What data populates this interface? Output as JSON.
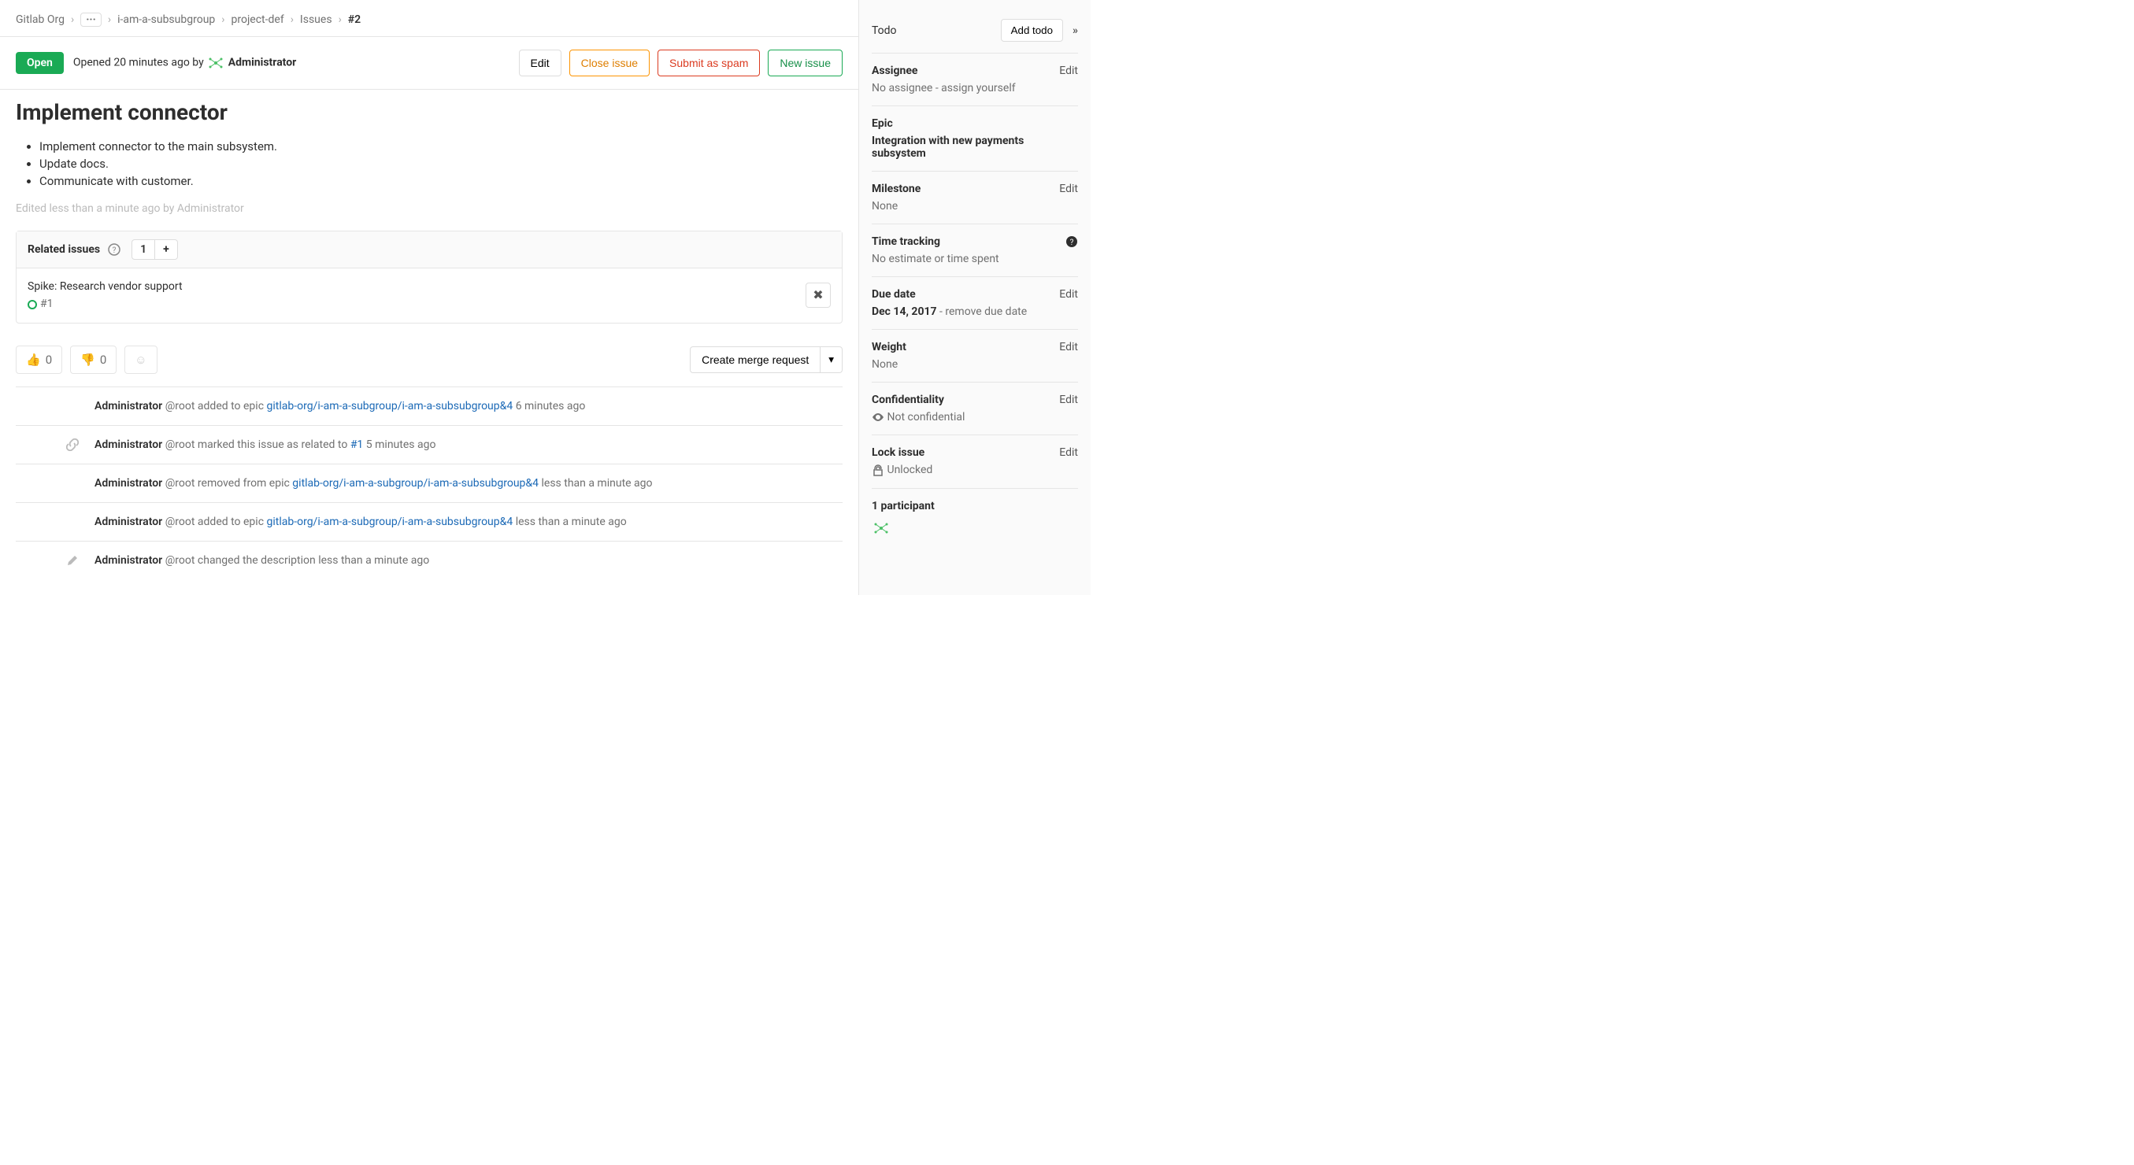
{
  "breadcrumbs": {
    "org": "Gitlab Org",
    "ellipsis": "···",
    "subsubgroup": "i-am-a-subsubgroup",
    "project": "project-def",
    "issues": "Issues",
    "issue_ref": "#2"
  },
  "header": {
    "status": "Open",
    "opened_text": "Opened 20 minutes ago by",
    "author": "Administrator",
    "actions": {
      "edit": "Edit",
      "close": "Close issue",
      "spam": "Submit as spam",
      "new": "New issue"
    }
  },
  "issue": {
    "title": "Implement connector",
    "bullets": [
      "Implement connector to the main subsystem.",
      "Update docs.",
      "Communicate with customer."
    ],
    "edited_note": "Edited less than a minute ago by Administrator"
  },
  "related": {
    "title": "Related issues",
    "count": "1",
    "item_title": "Spike: Research vendor support",
    "item_ref": "#1"
  },
  "reactions": {
    "thumbs_up": "0",
    "thumbs_down": "0",
    "mr_button": "Create merge request"
  },
  "activity": [
    {
      "icon": "",
      "author": "Administrator",
      "handle": "@root",
      "action_pre": "added to epic ",
      "link_text": "gitlab-org/i-am-a-subgroup/i-am-a-subsubgroup&4",
      "action_post": "",
      "time": "6 minutes ago"
    },
    {
      "icon": "link",
      "author": "Administrator",
      "handle": "@root",
      "action_pre": "marked this issue as related to ",
      "link_text": "#1",
      "action_post": "",
      "time": "5 minutes ago"
    },
    {
      "icon": "",
      "author": "Administrator",
      "handle": "@root",
      "action_pre": "removed from epic ",
      "link_text": "gitlab-org/i-am-a-subgroup/i-am-a-subsubgroup&4",
      "action_post": "",
      "time": "less than a minute ago"
    },
    {
      "icon": "",
      "author": "Administrator",
      "handle": "@root",
      "action_pre": "added to epic ",
      "link_text": "gitlab-org/i-am-a-subgroup/i-am-a-subsubgroup&4",
      "action_post": "",
      "time": "less than a minute ago"
    },
    {
      "icon": "pencil",
      "author": "Administrator",
      "handle": "@root",
      "action_pre": "changed the description ",
      "link_text": "",
      "action_post": "",
      "time": "less than a minute ago"
    }
  ],
  "sidebar": {
    "todo": {
      "label": "Todo",
      "button": "Add todo"
    },
    "assignee": {
      "label": "Assignee",
      "edit": "Edit",
      "value": "No assignee - ",
      "link": "assign yourself"
    },
    "epic": {
      "label": "Epic",
      "value": "Integration with new payments subsystem"
    },
    "milestone": {
      "label": "Milestone",
      "edit": "Edit",
      "value": "None"
    },
    "time": {
      "label": "Time tracking",
      "value": "No estimate or time spent"
    },
    "due": {
      "label": "Due date",
      "edit": "Edit",
      "value": "Dec 14, 2017",
      "remove": " - remove due date"
    },
    "weight": {
      "label": "Weight",
      "edit": "Edit",
      "value": "None"
    },
    "confidentiality": {
      "label": "Confidentiality",
      "edit": "Edit",
      "value": "Not confidential"
    },
    "lock": {
      "label": "Lock issue",
      "edit": "Edit",
      "value": "Unlocked"
    },
    "participants": {
      "label": "1 participant"
    }
  }
}
